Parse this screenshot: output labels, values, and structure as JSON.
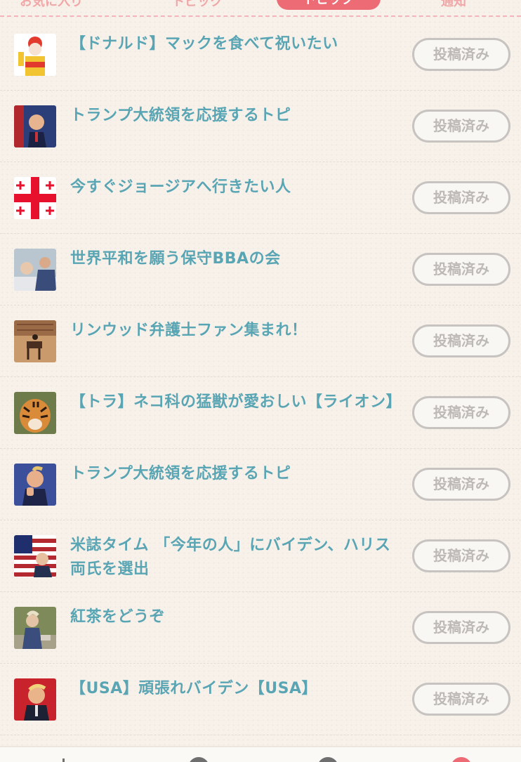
{
  "tabs": [
    "お気に入り",
    "トピック",
    "トピック",
    "通知"
  ],
  "status_label": "投稿済み",
  "topics": [
    {
      "title": "【ドナルド】マックを食べて祝いたい",
      "thumb_icon": "clown-mascot-image"
    },
    {
      "title": "トランプ大統領を応援するトピ",
      "thumb_icon": "portrait-photo-image"
    },
    {
      "title": "今すぐジョージアへ行きたい人",
      "thumb_icon": "georgia-flag-image"
    },
    {
      "title": "世界平和を願う保守BBAの会",
      "thumb_icon": "meeting-photo-image"
    },
    {
      "title": "リンウッド弁護士ファン集まれ！",
      "thumb_icon": "horse-rider-photo-image"
    },
    {
      "title": "【トラ】ネコ科の猛獣が愛おしい【ライオン】",
      "thumb_icon": "tiger-photo-image"
    },
    {
      "title": "トランプ大統領を応援するトピ",
      "thumb_icon": "thumbs-up-photo-image"
    },
    {
      "title": "米誌タイム 「今年の人」にバイデン、ハリス両氏を選出",
      "thumb_icon": "flag-portrait-photo-image"
    },
    {
      "title": "紅茶をどうぞ",
      "thumb_icon": "garden-photo-image"
    },
    {
      "title": "【USA】頑張れバイデン【USA】",
      "thumb_icon": "red-background-portrait-image"
    }
  ],
  "colors": {
    "accent": "#ec6b74",
    "title": "#5aa5b4",
    "button_border": "#c6c3c0"
  }
}
